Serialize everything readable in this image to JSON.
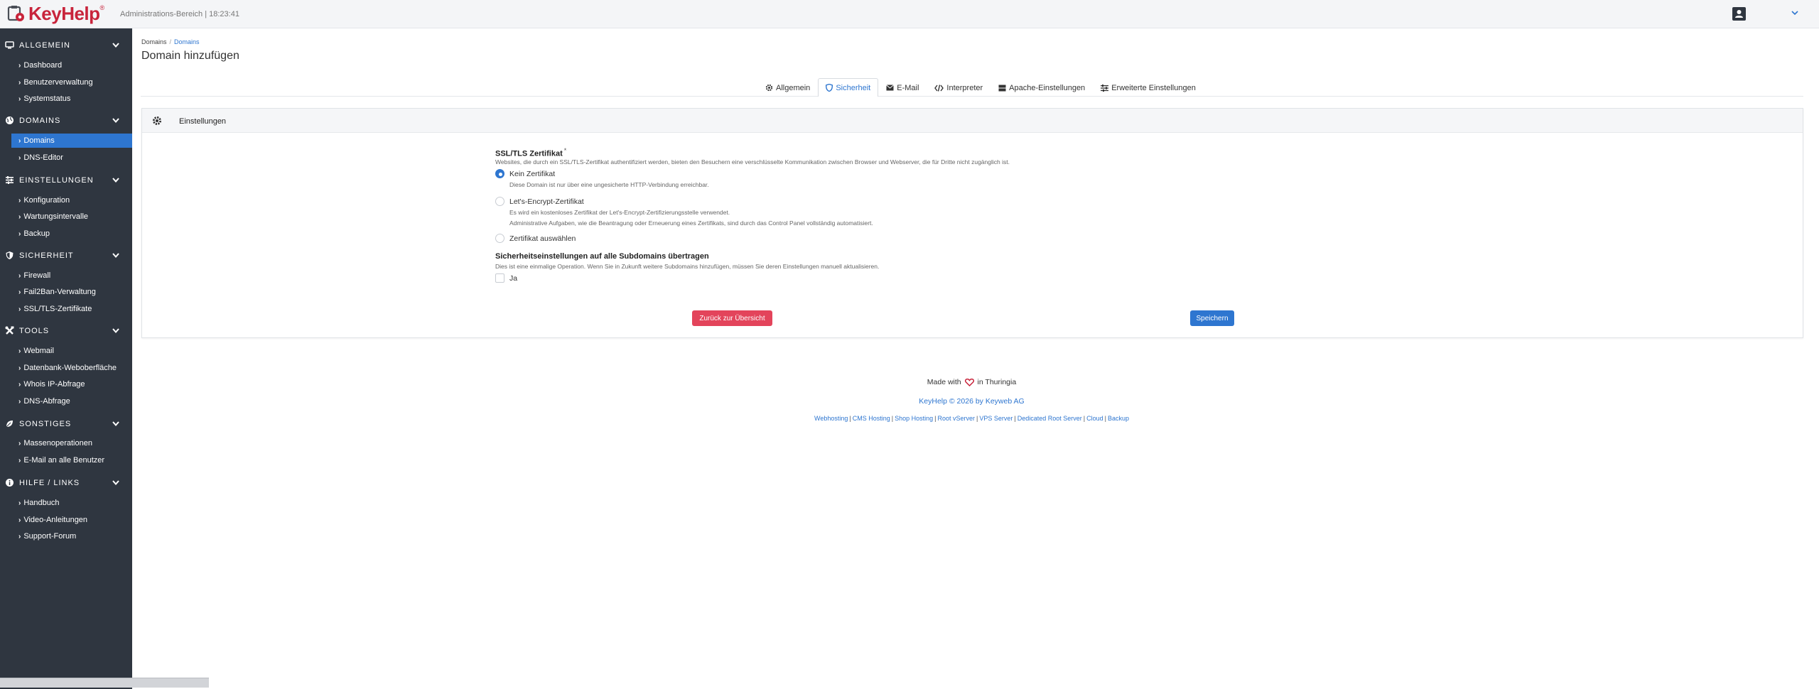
{
  "header": {
    "logo_text": "KeyHelp",
    "subtitle": "Administrations-Bereich | 18:23:41"
  },
  "sidebar": {
    "sections": [
      {
        "title": "ALLGEMEIN",
        "icon": "monitor-icon",
        "items": [
          "Dashboard",
          "Benutzerverwaltung",
          "Systemstatus"
        ]
      },
      {
        "title": "DOMAINS",
        "icon": "globe-icon",
        "items": [
          "Domains",
          "DNS-Editor"
        ]
      },
      {
        "title": "EINSTELLUNGEN",
        "icon": "sliders-icon",
        "items": [
          "Konfiguration",
          "Wartungsintervalle",
          "Backup"
        ]
      },
      {
        "title": "SICHERHEIT",
        "icon": "shield-icon",
        "items": [
          "Firewall",
          "Fail2Ban-Verwaltung",
          "SSL/TLS-Zertifikate"
        ]
      },
      {
        "title": "TOOLS",
        "icon": "tools-icon",
        "items": [
          "Webmail",
          "Datenbank-Weboberfläche",
          "Whois IP-Abfrage",
          "DNS-Abfrage"
        ]
      },
      {
        "title": "SONSTIGES",
        "icon": "leaf-icon",
        "items": [
          "Massenoperationen",
          "E-Mail an alle Benutzer"
        ]
      },
      {
        "title": "HILFE / LINKS",
        "icon": "info-icon",
        "items": [
          "Handbuch",
          "Video-Anleitungen",
          "Support-Forum"
        ]
      }
    ],
    "active_item": "Domains"
  },
  "breadcrumb": {
    "parent": "Domains",
    "current": "Domains"
  },
  "page_title": "Domain hinzufügen",
  "tabs": [
    {
      "label": "Allgemein",
      "icon": "gear-icon"
    },
    {
      "label": "Sicherheit",
      "icon": "shield-icon"
    },
    {
      "label": "E-Mail",
      "icon": "envelope-icon"
    },
    {
      "label": "Interpreter",
      "icon": "code-icon"
    },
    {
      "label": "Apache-Einstellungen",
      "icon": "server-icon"
    },
    {
      "label": "Erweiterte Einstellungen",
      "icon": "sliders-icon"
    }
  ],
  "card": {
    "title": "Einstellungen",
    "ssl": {
      "label": "SSL/TLS Zertifikat",
      "required_mark": "*",
      "help": "Websites, die durch ein SSL/TLS-Zertifikat authentifiziert werden, bieten den Besuchern eine verschlüsselte Kommunikation zwischen Browser und Webserver, die für Dritte nicht zugänglich ist.",
      "options": [
        {
          "label": "Kein Zertifikat",
          "help": "Diese Domain ist nur über eine ungesicherte HTTP-Verbindung erreichbar.",
          "help2": "",
          "checked": true
        },
        {
          "label": "Let's-Encrypt-Zertifikat",
          "help": "Es wird ein kostenloses Zertifikat der Let's-Encrypt-Zertifizierungsstelle verwendet.",
          "help2": "Administrative Aufgaben, wie die Beantragung oder Erneuerung eines Zertifikats, sind durch das Control Panel vollständig automatisiert.",
          "checked": false
        },
        {
          "label": "Zertifikat auswählen",
          "help": "",
          "help2": "",
          "checked": false
        }
      ]
    },
    "subdomains": {
      "label": "Sicherheitseinstellungen auf alle Subdomains übertragen",
      "help": "Dies ist eine einmalige Operation. Wenn Sie in Zukunft weitere Subdomains hinzufügen, müssen Sie deren Einstellungen manuell aktualisieren.",
      "checkbox_label": "Ja",
      "checked": false
    },
    "back_button": "Zurück zur Übersicht",
    "save_button": "Speichern"
  },
  "footer": {
    "made_before": "Made with",
    "made_after": "in Thuringia",
    "copyright": "KeyHelp © 2026 by Keyweb AG",
    "links": [
      "Webhosting",
      "CMS Hosting",
      "Shop Hosting",
      "Root vServer",
      "VPS Server",
      "Dedicated Root Server",
      "Cloud",
      "Backup"
    ]
  },
  "colors": {
    "accent": "#2e76d0",
    "danger": "#e3445b",
    "sidebar": "#2f3640",
    "brand": "#c8243b"
  }
}
